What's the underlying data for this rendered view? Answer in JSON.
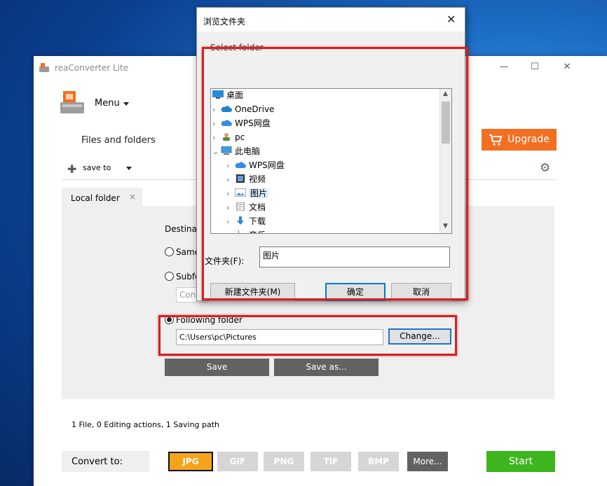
{
  "app": {
    "title": "reaConverter Lite",
    "menu_label": "Menu",
    "files_and_folders": "Files and folders",
    "upgrade_label": "Upgrade",
    "save_to_label": "save to",
    "tab_label": "Local folder",
    "tab_close": "×",
    "destination_label": "Destinati",
    "same_label": "Same",
    "subfolder_label": "Subfo",
    "subfolder_input": "Conv",
    "following_folder_label": "Following folder",
    "path_value": "C:\\Users\\pc\\Pictures",
    "change_label": "Change...",
    "save_label": "Save",
    "save_as_label": "Save as...",
    "status_text": "1 File, 0 Editing actions, 1 Saving path",
    "convert_to_label": "Convert to:",
    "formats": [
      "JPG",
      "GIF",
      "PNG",
      "TIF",
      "BMP",
      "More..."
    ],
    "active_format": "JPG",
    "start_label": "Start",
    "colors": {
      "upgrade": "#f36f21",
      "start": "#3cb51e",
      "active_format": "#f5a31a",
      "highlight": "#d42020"
    }
  },
  "dialog": {
    "title": "浏览文件夹",
    "close": "✕",
    "select_folder": "Select folder",
    "tree": [
      {
        "label": "桌面",
        "icon": "desktop-icon"
      },
      {
        "label": "OneDrive",
        "icon": "cloud-icon"
      },
      {
        "label": "WPS网盘",
        "icon": "cloud-icon"
      },
      {
        "label": "pc",
        "icon": "user-icon"
      },
      {
        "label": "此电脑",
        "icon": "computer-icon"
      },
      {
        "label": "WPS网盘",
        "icon": "cloud-icon"
      },
      {
        "label": "视频",
        "icon": "video-icon"
      },
      {
        "label": "图片",
        "icon": "pictures-icon"
      },
      {
        "label": "文档",
        "icon": "document-icon"
      },
      {
        "label": "下载",
        "icon": "download-icon"
      },
      {
        "label": "音乐",
        "icon": "music-icon"
      }
    ],
    "selected": "图片",
    "folder_label": "文件夹(F):",
    "folder_value": "图片",
    "new_folder_label": "新建文件夹(M)",
    "ok_label": "确定",
    "cancel_label": "取消"
  }
}
